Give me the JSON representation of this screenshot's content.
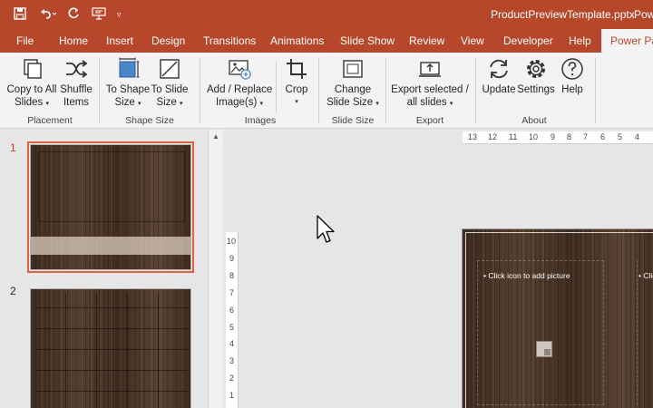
{
  "titlebar": {
    "file_name": "ProductPreviewTemplate.pptx",
    "app_name": "Pow",
    "quick_access": [
      "save-icon",
      "undo-icon",
      "redo-icon",
      "presenter-icon",
      "customize-icon"
    ]
  },
  "tabs": [
    "File",
    "Home",
    "Insert",
    "Design",
    "Transitions",
    "Animations",
    "Slide Show",
    "Review",
    "View",
    "Developer",
    "Help",
    "Power Pac"
  ],
  "ribbon": {
    "copy_line1": "Copy to All",
    "copy_line2": "Slides",
    "shuffle_line1": "Shuffle",
    "shuffle_line2": "Items",
    "placement_label": "Placement",
    "to_shape_line1": "To Shape",
    "to_shape_line2": "Size",
    "to_slide_line1": "To Slide",
    "to_slide_line2": "Size",
    "shape_size_label": "Shape Size",
    "add_replace_line1": "Add / Replace",
    "add_replace_line2": "Image(s)",
    "crop_line1": "Crop",
    "images_label": "Images",
    "change_line1": "Change",
    "change_line2": "Slide Size",
    "slide_size_label": "Slide Size",
    "export_line1": "Export selected /",
    "export_line2": "all slides",
    "export_label": "Export",
    "update_line1": "Update",
    "settings_line1": "Settings",
    "help_line1": "Help",
    "about_label": "About"
  },
  "thumbnails": {
    "slide1_number": "1",
    "slide2_number": "2"
  },
  "rulers": {
    "horizontal": [
      "13",
      "12",
      "11",
      "10",
      "9",
      "8",
      "7",
      "6",
      "5",
      "4"
    ],
    "vertical": [
      "10",
      "9",
      "8",
      "7",
      "6",
      "5",
      "4",
      "3",
      "2",
      "1"
    ]
  },
  "slide": {
    "placeholder1": "• Click icon to add picture",
    "placeholder2": "• Clic"
  },
  "colors": {
    "accent": "#b7472a",
    "selection": "#e0633f"
  }
}
